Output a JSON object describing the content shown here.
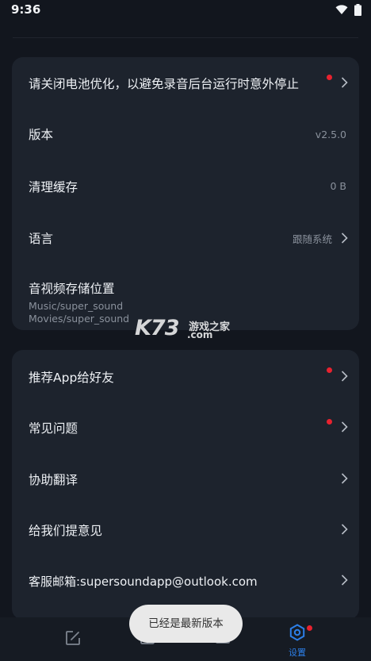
{
  "status_bar": {
    "time": "9:36"
  },
  "settings_group_1": {
    "battery": {
      "label": "请关闭电池优化，以避免录音后台运行时意外停止",
      "has_dot": true
    },
    "version": {
      "label": "版本",
      "value": "v2.5.0"
    },
    "cache": {
      "label": "清理缓存",
      "value": "0 B"
    },
    "language": {
      "label": "语言",
      "value": "跟随系统"
    },
    "storage": {
      "label": "音视频存储位置",
      "paths": [
        "Music/super_sound",
        "Movies/super_sound"
      ]
    }
  },
  "settings_group_2": {
    "recommend": {
      "label": "推荐App给好友",
      "has_dot": true
    },
    "faq": {
      "label": "常见问题",
      "has_dot": true
    },
    "translate": {
      "label": "协助翻译"
    },
    "feedback": {
      "label": "给我们提意见"
    },
    "email": {
      "label": "客服邮箱:supersoundapp@outlook.com"
    }
  },
  "bottom_nav": {
    "items": [
      {
        "icon": "edit-icon",
        "label": "",
        "active": false
      },
      {
        "icon": "gift-icon",
        "label": "",
        "active": false
      },
      {
        "icon": "folder-icon",
        "label": "",
        "active": false
      },
      {
        "icon": "settings-icon",
        "label": "设置",
        "active": true,
        "has_dot": true
      }
    ]
  },
  "toast": {
    "text": "已经是最新版本"
  },
  "watermark": {
    "brand": "K73",
    "site": "游戏之家",
    "domain": ".com"
  },
  "colors": {
    "background": "#12161e",
    "card": "#1d232d",
    "accent": "#2c7fe8",
    "dot": "#e8222f"
  }
}
